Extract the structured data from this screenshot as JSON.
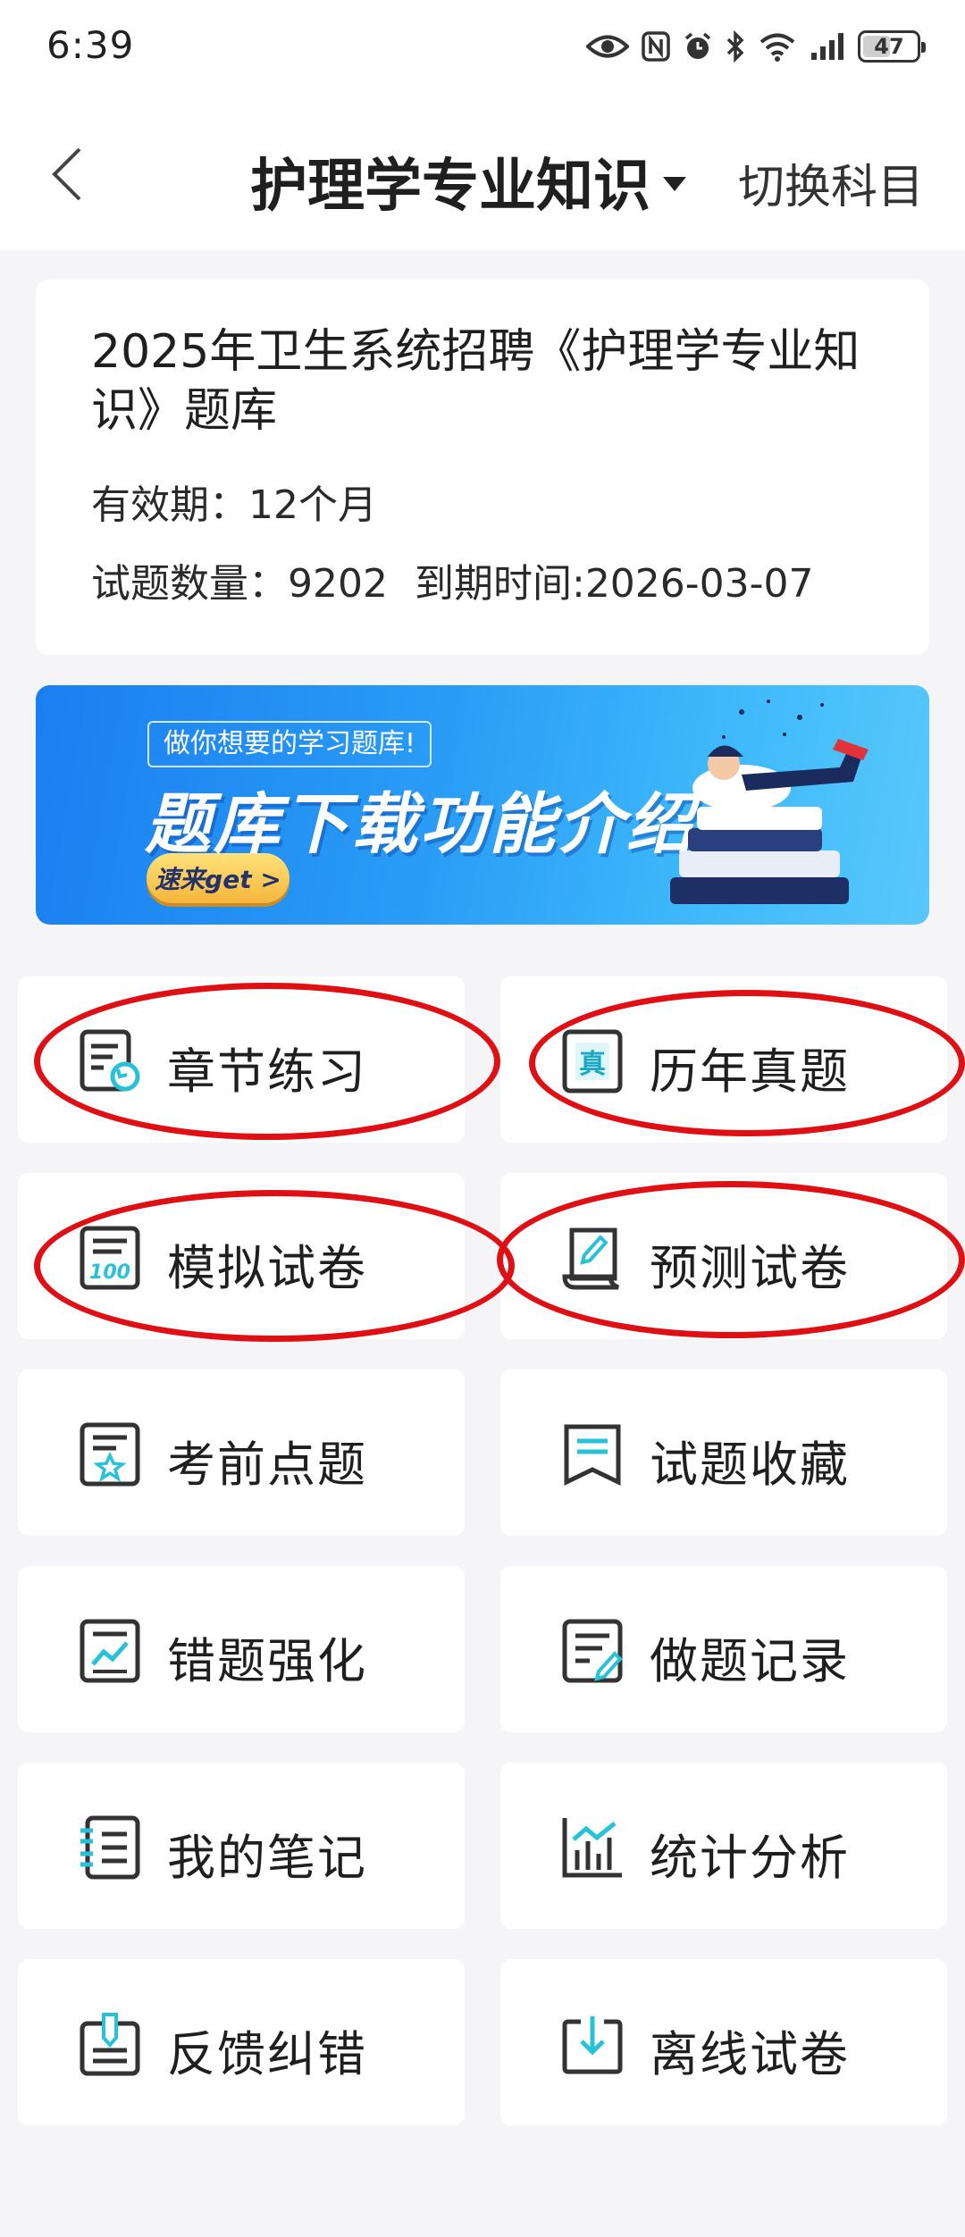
{
  "status_bar": {
    "time": "6:39",
    "battery": "47",
    "icons": [
      "eye-icon",
      "nfc-icon",
      "alarm-icon",
      "bluetooth-icon",
      "wifi-icon",
      "signal-icon",
      "battery-icon"
    ]
  },
  "header": {
    "title": "护理学专业知识",
    "switch_label": "切换科目"
  },
  "info_card": {
    "title": "2025年卫生系统招聘《护理学专业知识》题库",
    "validity_label": "有效期：",
    "validity_value": "12个月",
    "count_label": "试题数量：",
    "count_value": "9202",
    "expiry_label": "到期时间:",
    "expiry_value": "2026-03-07"
  },
  "banner": {
    "tag": "做你想要的学习题库!",
    "title": "题库下载功能介绍",
    "button": "速来get >"
  },
  "menu": [
    {
      "label": "章节练习",
      "icon": "chapter-practice-icon"
    },
    {
      "label": "历年真题",
      "icon": "past-exam-icon"
    },
    {
      "label": "模拟试卷",
      "icon": "mock-exam-icon"
    },
    {
      "label": "预测试卷",
      "icon": "forecast-exam-icon"
    },
    {
      "label": "考前点题",
      "icon": "star-doc-icon"
    },
    {
      "label": "试题收藏",
      "icon": "bookmark-icon"
    },
    {
      "label": "错题强化",
      "icon": "chart-doc-icon"
    },
    {
      "label": "做题记录",
      "icon": "record-icon"
    },
    {
      "label": "我的笔记",
      "icon": "notebook-icon"
    },
    {
      "label": "统计分析",
      "icon": "statistics-icon"
    },
    {
      "label": "反馈纠错",
      "icon": "feedback-icon"
    },
    {
      "label": "离线试卷",
      "icon": "download-icon"
    }
  ],
  "colors": {
    "accent": "#27c2d8",
    "annotation": "#e00f14",
    "banner_start": "#1a7ff0",
    "banner_end": "#58c8fb"
  }
}
